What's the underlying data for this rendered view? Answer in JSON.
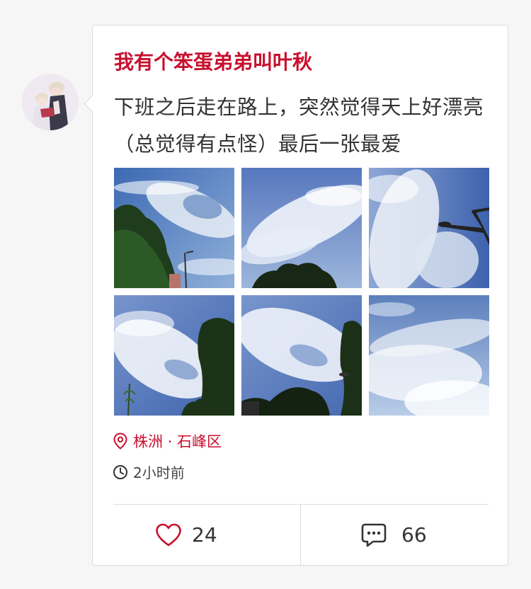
{
  "post": {
    "username": "我有个笨蛋弟弟叫叶秋",
    "content": "下班之后走在路上，突然觉得天上好漂亮（总觉得有点怪）最后一张最爱",
    "location": "株洲 · 石峰区",
    "time": "2小时前",
    "likes": "24",
    "comments": "66"
  },
  "colors": {
    "accent": "#c8102e",
    "text": "#333333",
    "sky": "#4a6fb3"
  },
  "icons": {
    "location": "location-pin-icon",
    "time": "clock-icon",
    "like": "heart-icon",
    "comment": "comment-bubble-icon"
  }
}
